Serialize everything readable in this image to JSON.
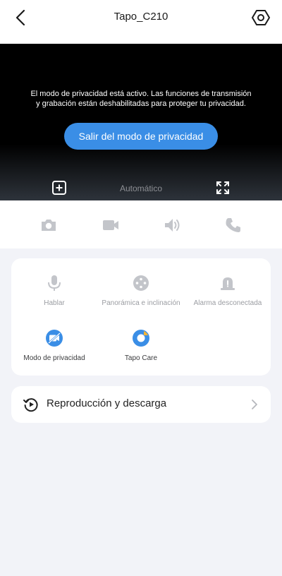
{
  "header": {
    "title": "Tapo_C210",
    "back_icon": "chevron-left-icon",
    "settings_icon": "hexagon-gear-icon"
  },
  "video": {
    "privacy_message": "El modo de privacidad está activo. Las funciones de transmisión y grabación están deshabilitadas para proteger tu privacidad.",
    "exit_button_label": "Salir del modo de privacidad",
    "quality_label": "Automático",
    "add_icon": "add-view-icon",
    "fullscreen_icon": "fullscreen-icon"
  },
  "toolbar": {
    "items": [
      {
        "icon": "camera-icon",
        "enabled": false
      },
      {
        "icon": "video-record-icon",
        "enabled": false
      },
      {
        "icon": "speaker-icon",
        "enabled": false
      },
      {
        "icon": "phone-icon",
        "enabled": false
      }
    ]
  },
  "features": {
    "items": [
      {
        "label": "Hablar",
        "icon": "microphone-icon",
        "enabled": false
      },
      {
        "label": "Panorámica e inclinación",
        "icon": "pan-tilt-icon",
        "enabled": false
      },
      {
        "label": "Alarma desconectada",
        "icon": "alarm-icon",
        "enabled": false
      },
      {
        "label": "Modo de privacidad",
        "icon": "privacy-icon",
        "enabled": true
      },
      {
        "label": "Tapo Care",
        "icon": "tapo-care-icon",
        "enabled": true
      }
    ]
  },
  "playback": {
    "label": "Reproducción y descarga",
    "icon": "playback-icon"
  },
  "colors": {
    "accent": "#3a8ee6",
    "disabled": "#b9bbc0",
    "background": "#f2f3f8"
  }
}
